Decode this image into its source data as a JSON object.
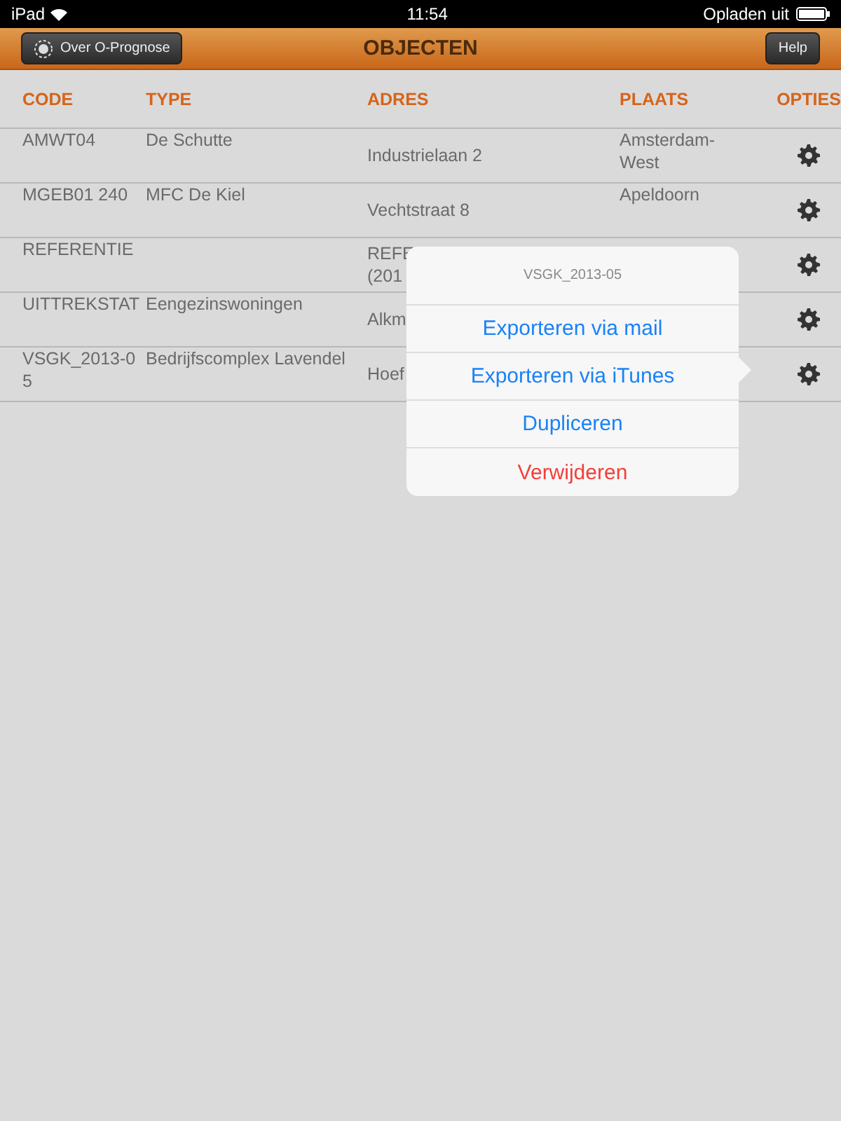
{
  "status_bar": {
    "device": "iPad",
    "time": "11:54",
    "charging": "Opladen uit"
  },
  "nav_bar": {
    "left_button": "Over O-Prognose",
    "title": "OBJECTEN",
    "right_button": "Help"
  },
  "table": {
    "columns": [
      "CODE",
      "TYPE",
      "ADRES",
      "PLAATS",
      "OPTIES"
    ],
    "rows": [
      {
        "code": "AMWT04",
        "type": "De Schutte",
        "adres": [
          "Industrielaan 2"
        ],
        "plaats": "Amsterdam-West"
      },
      {
        "code": "MGEB01 240",
        "type": "MFC De Kiel",
        "adres": [
          "Vechtstraat 8"
        ],
        "plaats": "Apeldoorn"
      },
      {
        "code": "REFERENTIE",
        "type": "",
        "adres": [
          "REFE",
          "(201"
        ],
        "plaats": ""
      },
      {
        "code": "UITTREKSTAT",
        "type": "Eengezinswoningen",
        "adres": [
          "Alkm"
        ],
        "plaats": ""
      },
      {
        "code": "VSGK_2013-05",
        "type": "Bedrijfscomplex Lavendel",
        "adres": [
          "Hoef"
        ],
        "plaats": ""
      }
    ]
  },
  "popover": {
    "title": "VSGK_2013-05",
    "items": [
      {
        "label": "Exporteren via mail",
        "kind": "normal"
      },
      {
        "label": "Exporteren via iTunes",
        "kind": "normal"
      },
      {
        "label": "Dupliceren",
        "kind": "normal"
      },
      {
        "label": "Verwijderen",
        "kind": "destructive"
      }
    ]
  }
}
